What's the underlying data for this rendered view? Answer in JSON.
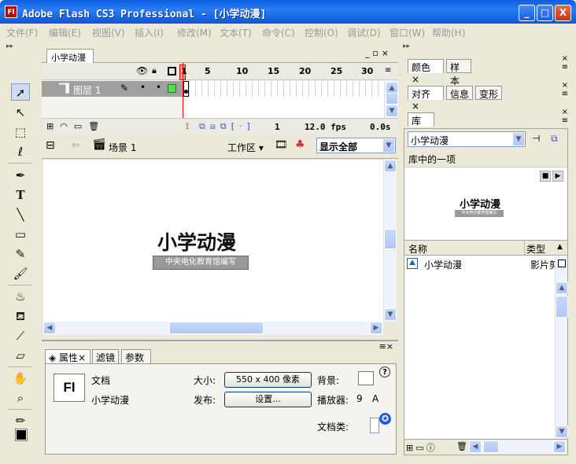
{
  "window": {
    "title": "Adobe Flash CS3 Professional - [小学动漫]",
    "logo": "Fl",
    "buttons": [
      "_",
      "□",
      "X"
    ]
  },
  "menu": [
    "文件(F)",
    "编辑(E)",
    "视图(V)",
    "插入(I)",
    "修改(M)",
    "文本(T)",
    "命令(C)",
    "控制(O)",
    "调试(D)",
    "窗口(W)",
    "帮助(H)"
  ],
  "tools": [
    "selection-icon",
    "subselection-icon",
    "free-transform-icon",
    "lasso-icon",
    "pen-icon",
    "text-icon",
    "line-icon",
    "rectangle-icon",
    "pencil-icon",
    "brush-icon",
    "ink-bottle-icon",
    "paint-bucket-icon",
    "eyedropper-icon",
    "eraser-icon",
    "hand-icon",
    "zoom-icon",
    "stroke-color-icon",
    "fill-color-icon"
  ],
  "document": {
    "tab": "小学动漫",
    "timeline": {
      "frame_numbers": [
        "1",
        "5",
        "10",
        "15",
        "20",
        "25",
        "30"
      ],
      "layer": "图层 1",
      "current_frame": "1",
      "fps": "12.0 fps",
      "time": "0.0s"
    },
    "edit_bar": {
      "scene": "场景 1",
      "workspace": "工作区",
      "zoom": "显示全部"
    },
    "stage": {
      "title": "小学动漫",
      "subtitle": "中央电化教育馆编写"
    }
  },
  "properties": {
    "tabs": [
      "属性",
      "滤镜",
      "参数"
    ],
    "type": "文档",
    "doc_name": "小学动漫",
    "size_label": "大小:",
    "size_value": "550 x 400 像素",
    "publish_label": "发布:",
    "settings_button": "设置...",
    "bg_label": "背景:",
    "player_label": "播放器:",
    "player_value": "9",
    "actionscript": "A",
    "docclass_label": "文档类:",
    "logo": "Fl"
  },
  "panels": {
    "color_tabs": [
      "颜色",
      "样本"
    ],
    "align_tabs": [
      "对齐",
      "信息",
      "变形"
    ],
    "library": {
      "tab": "库",
      "doc_select": "小学动漫",
      "count": "库中的一项",
      "preview_title": "小学动漫",
      "preview_subtitle": "中央电化教育馆编写",
      "col_name": "名称",
      "col_type": "类型",
      "items": [
        {
          "name": "小学动漫",
          "type": "影片剪"
        }
      ]
    }
  },
  "colors": {
    "titlebar": "#0a5fe0",
    "stage_bg": "#ffffff",
    "subtitle_bg": "#999999",
    "playhead": "#ff0000"
  }
}
